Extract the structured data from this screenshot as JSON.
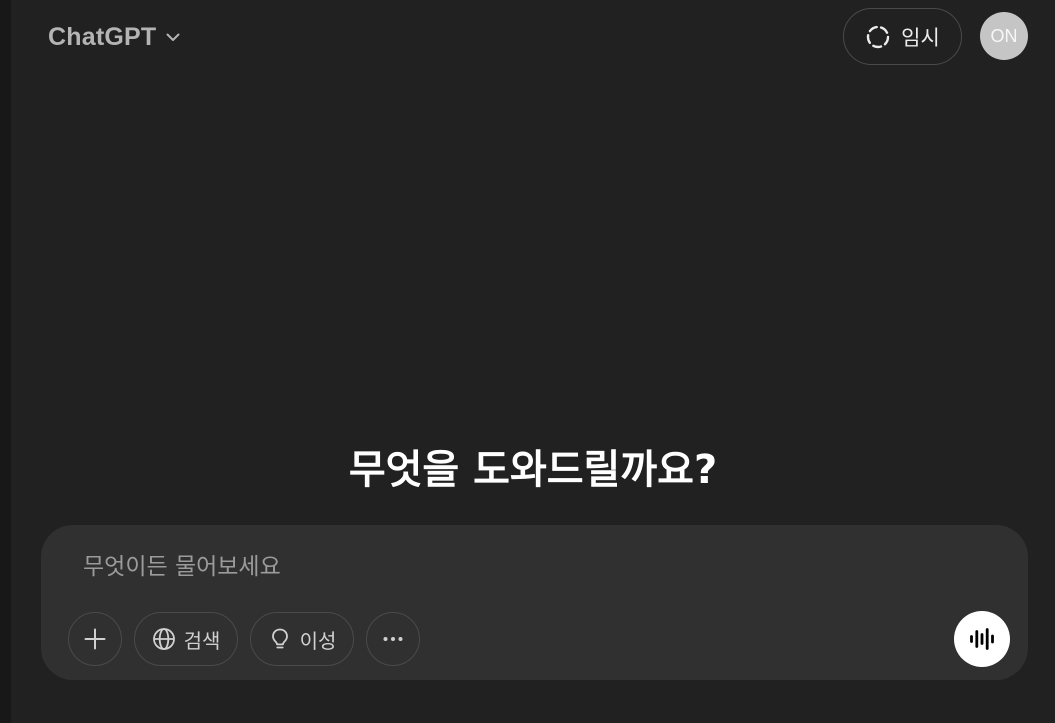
{
  "header": {
    "model_name": "ChatGPT",
    "temp_chat_label": "임시",
    "avatar_initials": "ON"
  },
  "main": {
    "title": "무엇을 도와드릴까요?"
  },
  "composer": {
    "placeholder": "무엇이든 물어보세요",
    "value": "",
    "tools": {
      "search_label": "검색",
      "reason_label": "이성"
    }
  },
  "icons": {
    "model_menu": "chevron-down-icon",
    "temp_chat": "dashed-circle-icon",
    "add": "plus-icon",
    "search": "globe-icon",
    "reason": "lightbulb-icon",
    "more": "ellipsis-icon",
    "voice": "voice-waveform-icon"
  },
  "colors": {
    "background": "#212121",
    "composer": "#303030",
    "avatar": "#c5c5c5",
    "voice_button": "#ffffff"
  }
}
